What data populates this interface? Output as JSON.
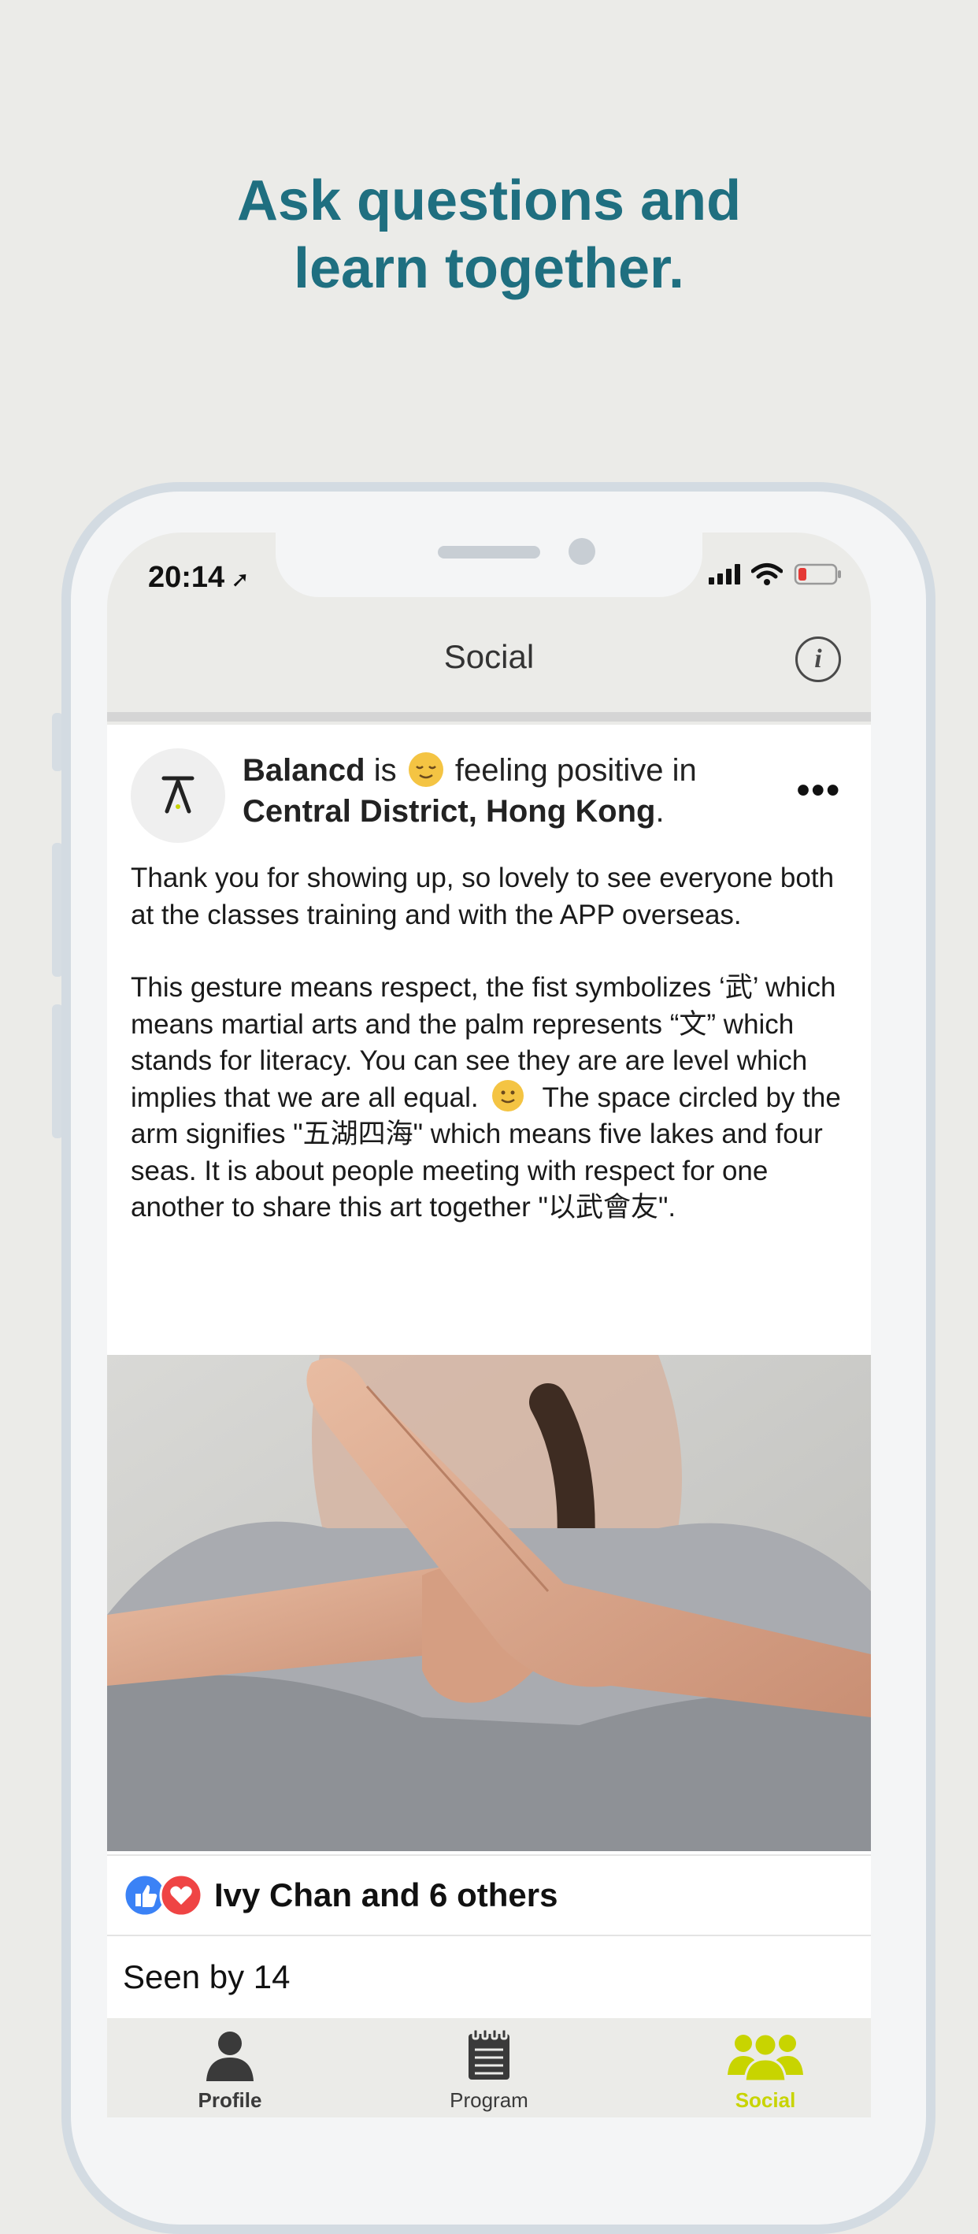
{
  "headline": {
    "line1": "Ask questions and",
    "line2": "learn together."
  },
  "status_bar": {
    "time": "20:14",
    "location_icon": "location-arrow-icon",
    "battery": "low"
  },
  "navbar": {
    "title": "Social",
    "info_icon": "info-icon"
  },
  "post": {
    "author": "Balancd",
    "verb": "is",
    "feeling": "feeling positive in",
    "location": "Central District, Hong Kong",
    "more_icon": "ellipsis-icon",
    "paragraph1": "Thank you for showing up, so lovely to see everyone both at the classes training and with the APP overseas.",
    "paragraph2_a": "This gesture means respect, the fist symbolizes ‘武’ which means martial arts and the palm represents “文” which stands for literacy. You can see they are are level which implies that we are all equal.",
    "paragraph2_b": "The space circled by the arm signifies \"五湖四海\" which means five lakes and four seas. It is about people meeting with respect for one another to share this art together \"以武會友\".",
    "reactions_text": "Ivy Chan and 6 others",
    "seen_text": "Seen by 14"
  },
  "tabs": [
    {
      "label": "Profile",
      "icon": "person-icon",
      "active": false
    },
    {
      "label": "Program",
      "icon": "notepad-icon",
      "active": false
    },
    {
      "label": "Social",
      "icon": "group-icon",
      "active": true
    }
  ],
  "colors": {
    "accent": "#1f6f80",
    "active_tab": "#c8d400",
    "like": "#3b82f6",
    "love": "#ef4444"
  }
}
